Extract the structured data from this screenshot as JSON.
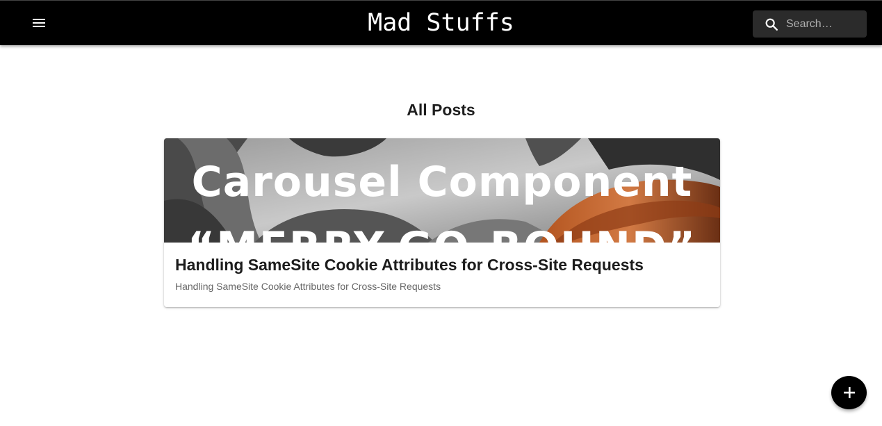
{
  "header": {
    "menu_icon": "menu-icon",
    "brand": "Mad Stuffs",
    "search": {
      "placeholder": "Search…",
      "icon": "search-icon"
    }
  },
  "main": {
    "title": "All Posts",
    "posts": [
      {
        "image_text_line1": "Carousel Component",
        "image_text_line2": "“MERRY-GO-ROUND”",
        "title": "Handling SameSite Cookie Attributes for Cross-Site Requests",
        "summary": "Handling SameSite Cookie Attributes for Cross-Site Requests"
      }
    ]
  },
  "fab": {
    "icon": "plus-icon"
  },
  "colors": {
    "appbar": "#000000",
    "search_bg": "#2b2b2b",
    "fab": "#000000"
  }
}
